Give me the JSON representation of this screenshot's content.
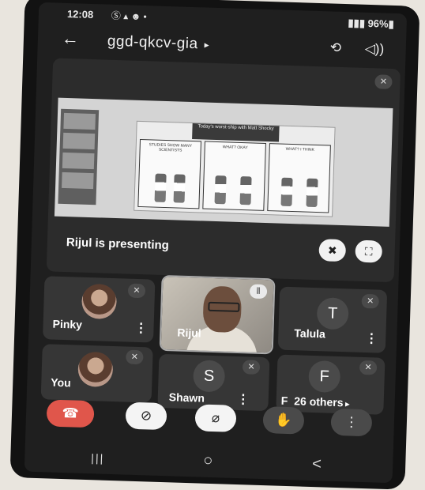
{
  "status": {
    "time": "12:08",
    "left_icons": "Ⓢ ▴ ☻ •",
    "battery": "96%"
  },
  "appbar": {
    "back_icon": "arrow-left",
    "meeting_code": "ggd-qkcv-gia",
    "caret": "▸",
    "switch_camera_icon": "camera-switch-icon",
    "audio_icon": "speaker-icon"
  },
  "presentation": {
    "label": "Rijul is presenting",
    "slide_title": "Today's worst-ship with Matt Shocky"
  },
  "participants": [
    {
      "name": "Pinky",
      "avatar": "photo",
      "muted": true
    },
    {
      "name": "Rijul",
      "avatar": "video",
      "speaking": true
    },
    {
      "name": "Talula",
      "avatar": "T",
      "muted": true
    },
    {
      "name": "You",
      "avatar": "photo",
      "muted": true
    },
    {
      "name": "Shawn",
      "avatar": "S",
      "muted": true
    },
    {
      "name": "F",
      "avatar": "F",
      "muted": true,
      "others_label": "26 others"
    }
  ],
  "controls": {
    "end_call": "☎",
    "camera_off": "⊘",
    "mic_off": "⌀",
    "raise_hand": "✋",
    "more": "⋮"
  },
  "navbar": {
    "recent": "|||",
    "home": "○",
    "back": "<"
  },
  "colors": {
    "end_call": "#e0564b",
    "tile_bg": "#363636",
    "screen_bg": "#1f1f1f"
  }
}
